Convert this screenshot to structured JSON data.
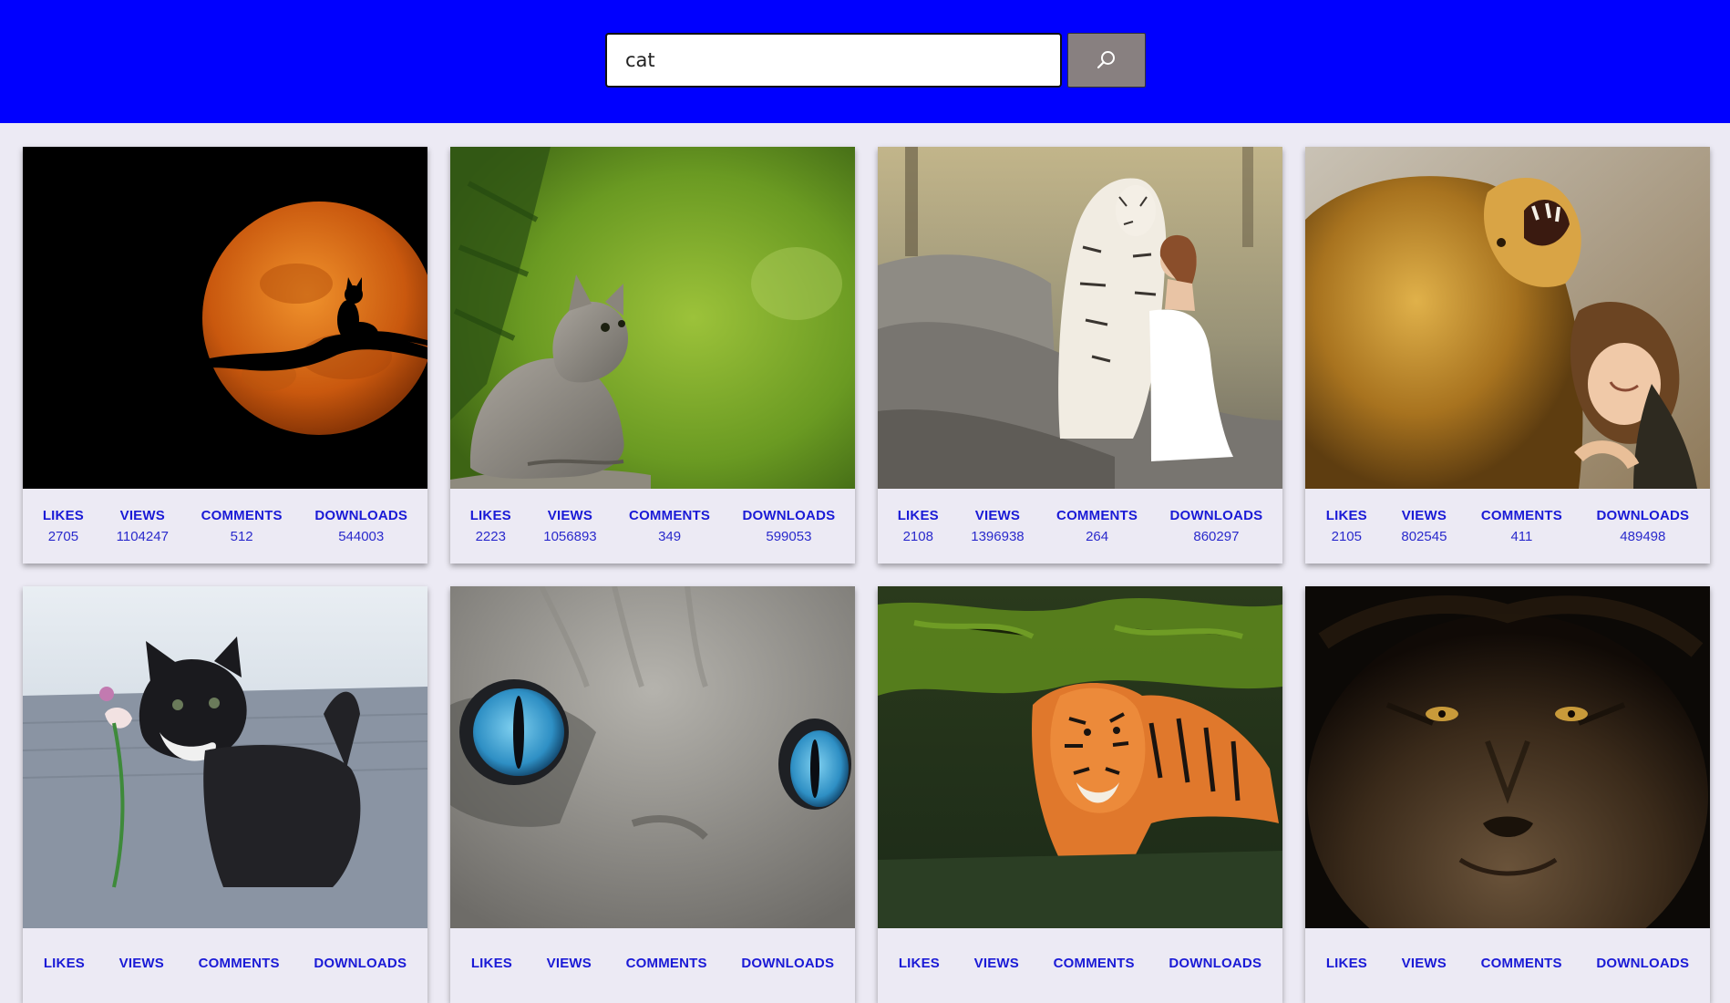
{
  "search": {
    "value": "cat",
    "button_icon": "search-icon"
  },
  "stat_labels": {
    "likes": "LIKES",
    "views": "VIEWS",
    "comments": "COMMENTS",
    "downloads": "DOWNLOADS"
  },
  "cards": [
    {
      "subject": "cat silhouette on branch against orange moon",
      "likes": "2705",
      "views": "1104247",
      "comments": "512",
      "downloads": "544003"
    },
    {
      "subject": "grey kitten sitting on rock in green forest",
      "likes": "2223",
      "views": "1056893",
      "comments": "349",
      "downloads": "599053"
    },
    {
      "subject": "white tiger with woman in white dress on rocks",
      "likes": "2108",
      "views": "1396938",
      "comments": "264",
      "downloads": "860297"
    },
    {
      "subject": "roaring lion hugged by smiling girl",
      "likes": "2105",
      "views": "802545",
      "comments": "411",
      "downloads": "489498"
    },
    {
      "subject": "black and white kitten pawing a flower",
      "likes": "",
      "views": "",
      "comments": "",
      "downloads": ""
    },
    {
      "subject": "close-up of cat blue eyes",
      "likes": "",
      "views": "",
      "comments": "",
      "downloads": ""
    },
    {
      "subject": "tiger swimming in green water",
      "likes": "",
      "views": "",
      "comments": "",
      "downloads": ""
    },
    {
      "subject": "lion face in dark",
      "likes": "",
      "views": "",
      "comments": "",
      "downloads": ""
    }
  ]
}
